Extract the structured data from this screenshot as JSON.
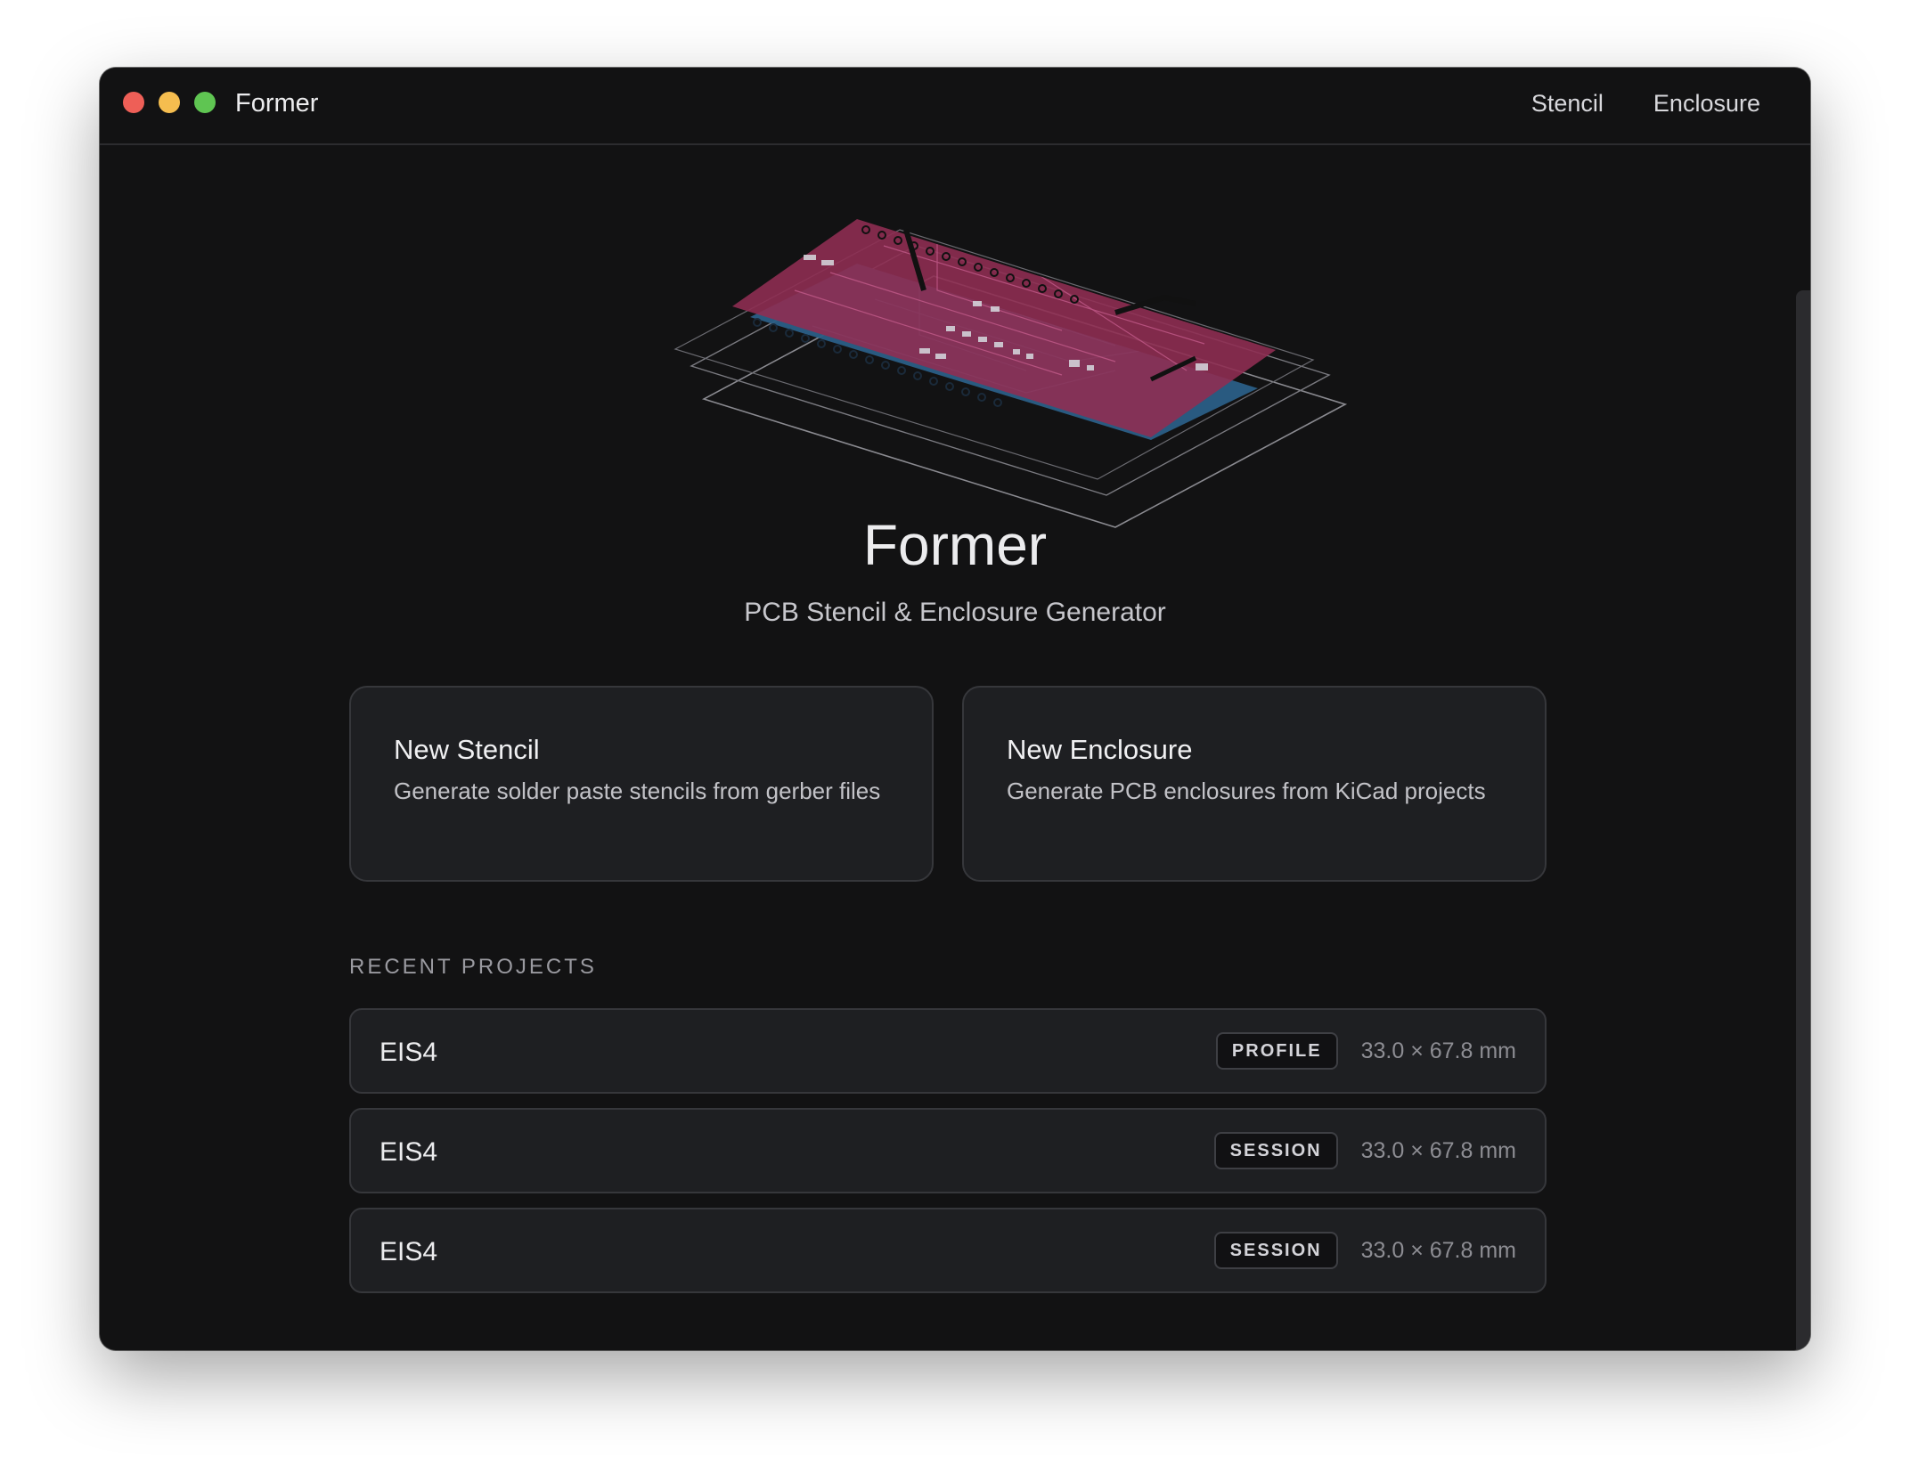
{
  "window": {
    "title": "Former",
    "nav": [
      "Stencil",
      "Enclosure"
    ]
  },
  "hero": {
    "title": "Former",
    "subtitle": "PCB Stencil & Enclosure Generator",
    "illustration_icon": "pcb-layers-illustration"
  },
  "cards": [
    {
      "title": "New Stencil",
      "description": "Generate solder paste stencils from gerber files"
    },
    {
      "title": "New Enclosure",
      "description": "Generate PCB enclosures from KiCad projects"
    }
  ],
  "recent": {
    "header": "RECENT PROJECTS",
    "projects": [
      {
        "name": "EIS4",
        "badge": "PROFILE",
        "dimensions": "33.0 × 67.8 mm"
      },
      {
        "name": "EIS4",
        "badge": "SESSION",
        "dimensions": "33.0 × 67.8 mm"
      },
      {
        "name": "EIS4",
        "badge": "SESSION",
        "dimensions": "33.0 × 67.8 mm"
      }
    ]
  },
  "colors": {
    "background": "#121213",
    "card": "#1e1f22",
    "pcb_top": "#8e2d52",
    "pcb_bottom": "#2b5f86",
    "traffic_red": "#ee5f57",
    "traffic_yellow": "#f5bd4f",
    "traffic_green": "#5fc552"
  }
}
